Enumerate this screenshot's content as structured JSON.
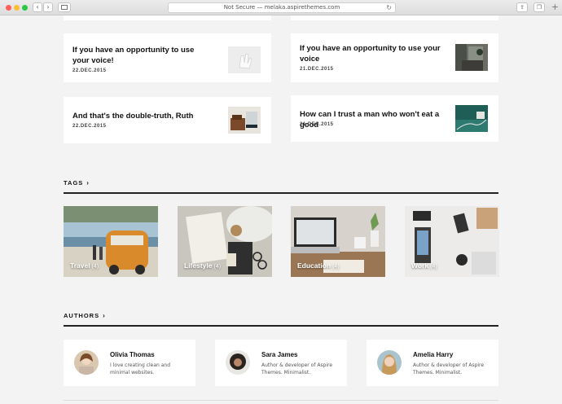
{
  "browser": {
    "address": "Not Secure — melaka.aspirethemes.com",
    "back_icon": "chevron-left-icon",
    "forward_icon": "chevron-right-icon"
  },
  "posts": [
    {
      "title": "If you have an opportunity to use your voice!",
      "date": "22.DEC.2015"
    },
    {
      "title": "If you have an opportunity to use your voice",
      "date": "21.DEC.2015"
    },
    {
      "title": "And that's the double-truth, Ruth",
      "date": "22.DEC.2015"
    },
    {
      "title": "How can I trust a man who won't eat a good",
      "date": "21.DEC.2015"
    }
  ],
  "tags_section": {
    "heading": "TAGS"
  },
  "tags": [
    {
      "name": "Travel",
      "count": "(4)"
    },
    {
      "name": "Lifestyle",
      "count": "(4)"
    },
    {
      "name": "Education",
      "count": "(4)"
    },
    {
      "name": "Work",
      "count": "(4)"
    }
  ],
  "authors_section": {
    "heading": "AUTHORS"
  },
  "authors": [
    {
      "name": "Olivia Thomas",
      "bio": "I love creating clean and minimal websites."
    },
    {
      "name": "Sara James",
      "bio": "Author & developer of Aspire Themes. Minimalist."
    },
    {
      "name": "Amelia Harry",
      "bio": "Author & developer of Aspire Themes. Minimalist."
    }
  ]
}
